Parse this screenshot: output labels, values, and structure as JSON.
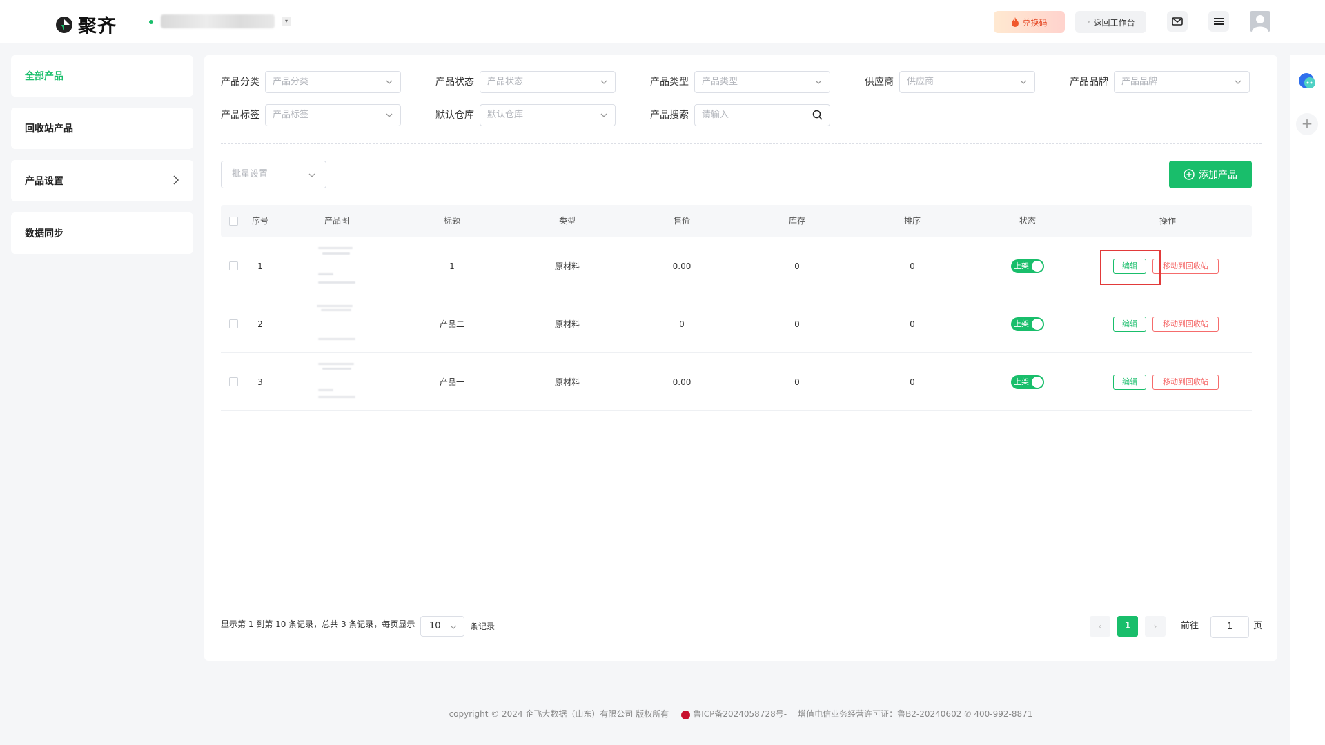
{
  "header": {
    "brand": "聚齐",
    "redeem_label": "兑换码",
    "return_label": "返回工作台"
  },
  "sidebar": {
    "items": [
      {
        "label": "全部产品"
      },
      {
        "label": "回收站产品"
      },
      {
        "label": "产品设置"
      },
      {
        "label": "数据同步"
      }
    ]
  },
  "filters": {
    "category": {
      "label": "产品分类",
      "placeholder": "产品分类"
    },
    "status": {
      "label": "产品状态",
      "placeholder": "产品状态"
    },
    "type": {
      "label": "产品类型",
      "placeholder": "产品类型"
    },
    "supplier": {
      "label": "供应商",
      "placeholder": "供应商"
    },
    "brand": {
      "label": "产品品牌",
      "placeholder": "产品品牌"
    },
    "tag": {
      "label": "产品标签",
      "placeholder": "产品标签"
    },
    "warehouse": {
      "label": "默认仓库",
      "placeholder": "默认仓库"
    },
    "search": {
      "label": "产品搜索",
      "placeholder": "请输入"
    }
  },
  "toolbar": {
    "batch_placeholder": "批量设置",
    "add_label": "添加产品"
  },
  "table": {
    "columns": {
      "index": "序号",
      "image": "产品图",
      "title": "标题",
      "type": "类型",
      "price": "售价",
      "stock": "库存",
      "sort": "排序",
      "status": "状态",
      "actions": "操作"
    },
    "rows": [
      {
        "index": "1",
        "title": "1",
        "type": "原材料",
        "price": "0.00",
        "stock": "0",
        "sort": "0",
        "status": "上架",
        "edit": "编辑",
        "move": "移动到回收站"
      },
      {
        "index": "2",
        "title": "产品二",
        "type": "原材料",
        "price": "0",
        "stock": "0",
        "sort": "0",
        "status": "上架",
        "edit": "编辑",
        "move": "移动到回收站"
      },
      {
        "index": "3",
        "title": "产品一",
        "type": "原材料",
        "price": "0.00",
        "stock": "0",
        "sort": "0",
        "status": "上架",
        "edit": "编辑",
        "move": "移动到回收站"
      }
    ]
  },
  "pagination": {
    "info": "显示第 1 到第 10 条记录，总共 3 条记录，每页显示",
    "page_size": "10",
    "unit": "条记录",
    "prev": "‹",
    "current": "1",
    "next": "›",
    "goto_label": "前往",
    "goto_value": "1",
    "page_suffix": "页"
  },
  "footer": {
    "copyright": "copyright © 2024 企飞大数据（山东）有限公司 版权所有",
    "icp": "鲁ICP备2024058728号-",
    "license": "增值电信业务经营许可证：鲁B2-20240602",
    "phone": "400-992-8871"
  },
  "colors": {
    "accent": "#19be6b",
    "danger": "#f56c6c",
    "highlight": "#e23a3a"
  }
}
